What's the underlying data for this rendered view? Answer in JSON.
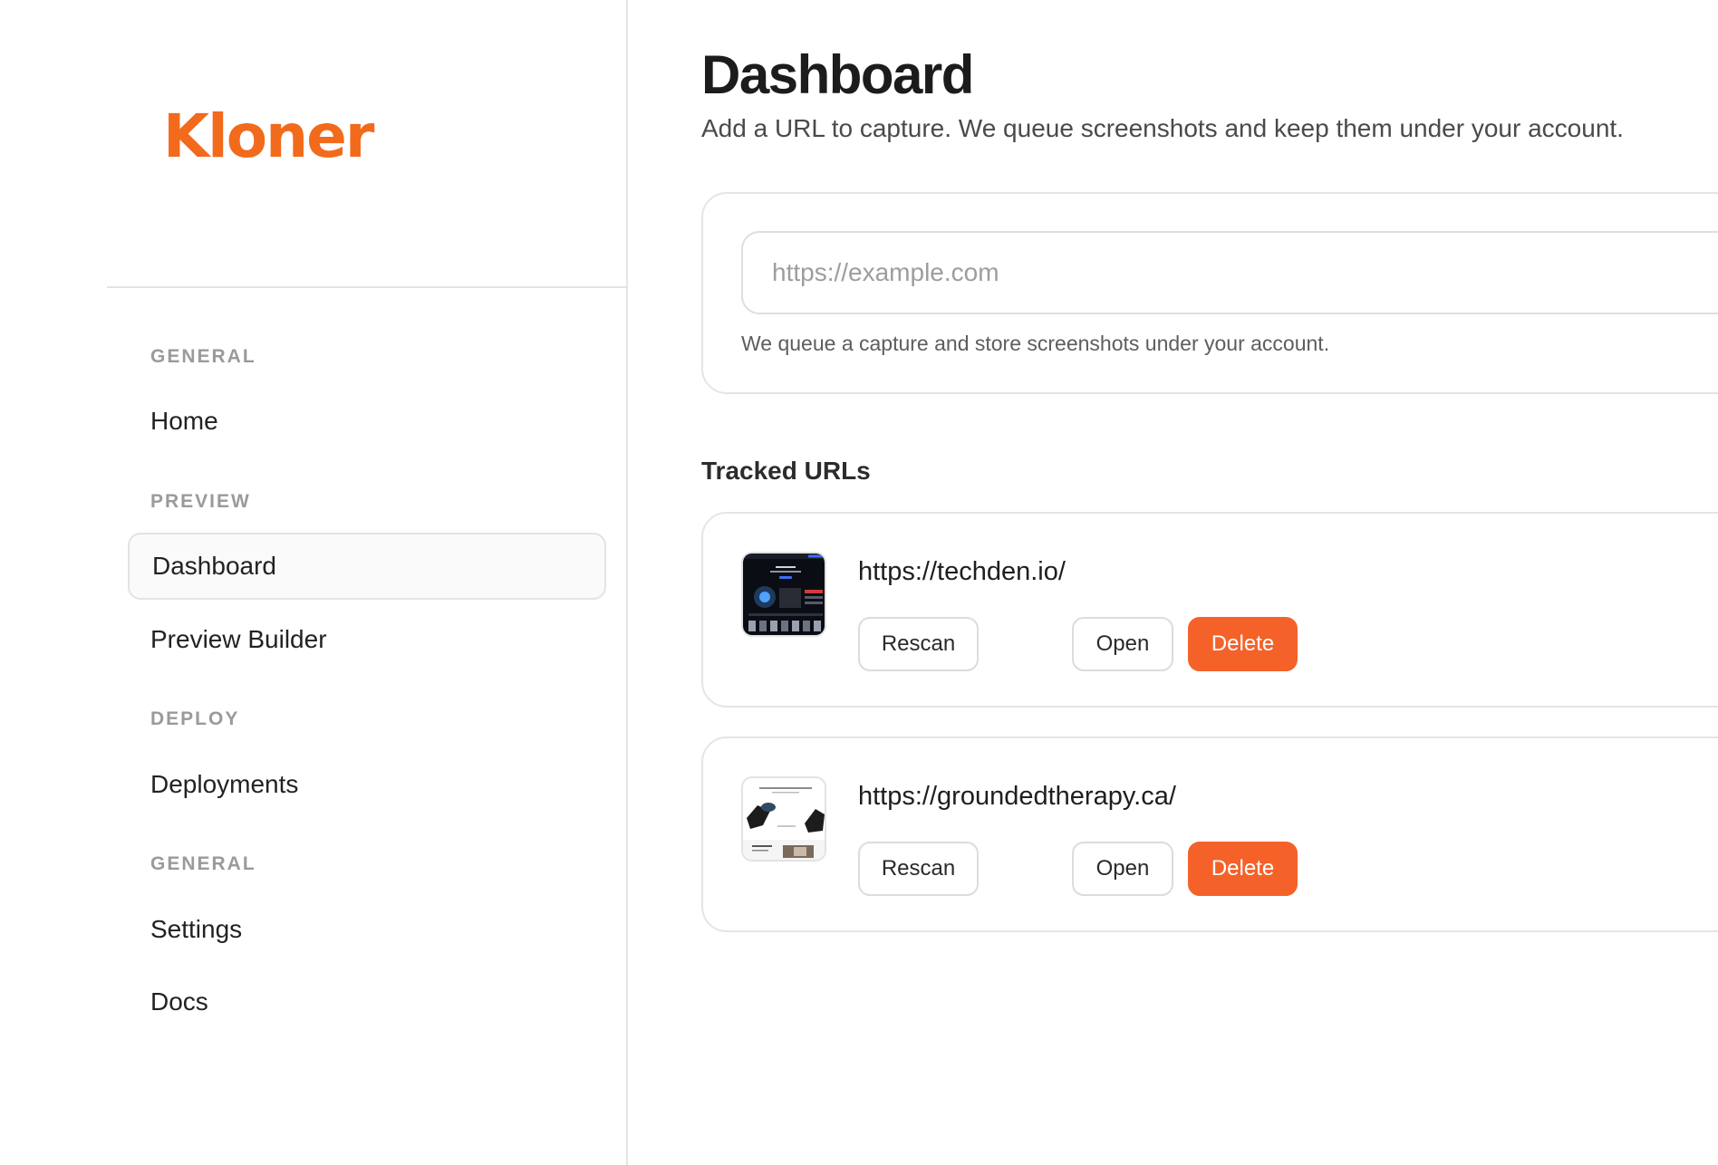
{
  "brand": {
    "name": "Kloner",
    "accent_color": "#f26a1b"
  },
  "sidebar": {
    "sections": [
      {
        "label": "GENERAL",
        "items": [
          {
            "label": "Home",
            "active": false
          }
        ]
      },
      {
        "label": "PREVIEW",
        "items": [
          {
            "label": "Dashboard",
            "active": true
          },
          {
            "label": "Preview Builder",
            "active": false
          }
        ]
      },
      {
        "label": "DEPLOY",
        "items": [
          {
            "label": "Deployments",
            "active": false
          }
        ]
      },
      {
        "label": "GENERAL",
        "items": [
          {
            "label": "Settings",
            "active": false
          },
          {
            "label": "Docs",
            "active": false
          }
        ]
      }
    ]
  },
  "main": {
    "title": "Dashboard",
    "subtitle": "Add a URL to capture. We queue screenshots and keep them under your account.",
    "capture": {
      "placeholder": "https://example.com",
      "value": "",
      "hint": "We queue a capture and store screenshots under your account."
    },
    "tracked_title": "Tracked URLs",
    "tracked_urls": [
      {
        "url": "https://techden.io/",
        "thumbnail": "dark-website-thumbnail",
        "rescan_label": "Rescan",
        "open_label": "Open",
        "delete_label": "Delete"
      },
      {
        "url": "https://groundedtherapy.ca/",
        "thumbnail": "light-website-thumbnail",
        "rescan_label": "Rescan",
        "open_label": "Open",
        "delete_label": "Delete"
      }
    ]
  },
  "colors": {
    "danger": "#f4622a",
    "border": "#e5e5e5",
    "muted_text": "#9a9a9a"
  }
}
